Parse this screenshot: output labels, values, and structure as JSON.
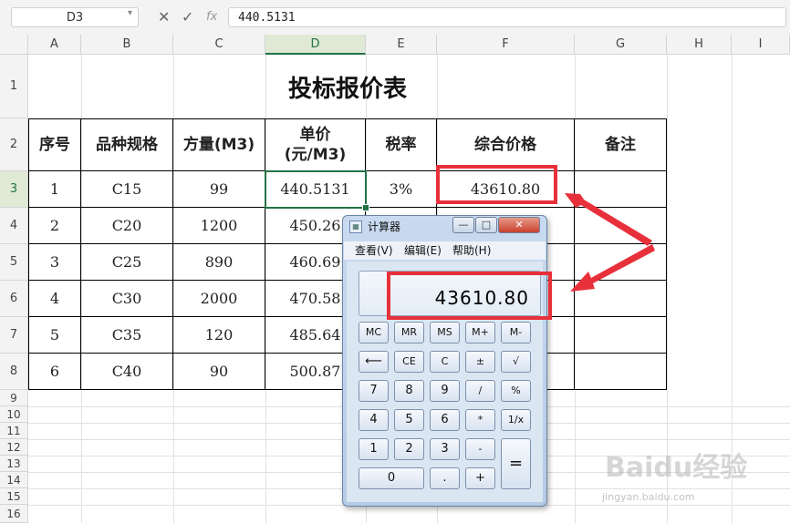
{
  "formula_bar": {
    "name_box": "D3",
    "cancel_icon": "✕",
    "confirm_icon": "✓",
    "fx_label": "fx",
    "formula": "440.5131"
  },
  "columns": [
    "A",
    "B",
    "C",
    "D",
    "E",
    "F",
    "G",
    "H",
    "I"
  ],
  "rows": [
    "1",
    "2",
    "3",
    "4",
    "5",
    "6",
    "7",
    "8",
    "9",
    "10",
    "11",
    "12",
    "13",
    "14",
    "15",
    "16"
  ],
  "sheet": {
    "title": "投标报价表",
    "headers": {
      "seq": "序号",
      "spec": "品种规格",
      "volume": "方量(M3)",
      "price_line1": "单价",
      "price_line2": "(元/M3)",
      "tax": "税率",
      "total": "综合价格",
      "note": "备注"
    },
    "data": [
      {
        "seq": "1",
        "spec": "C15",
        "volume": "99",
        "price": "440.5131",
        "tax": "3%",
        "total": "43610.80"
      },
      {
        "seq": "2",
        "spec": "C20",
        "volume": "1200",
        "price": "450.26",
        "tax": "",
        "total": ""
      },
      {
        "seq": "3",
        "spec": "C25",
        "volume": "890",
        "price": "460.69",
        "tax": "",
        "total": ""
      },
      {
        "seq": "4",
        "spec": "C30",
        "volume": "2000",
        "price": "470.58",
        "tax": "",
        "total": ""
      },
      {
        "seq": "5",
        "spec": "C35",
        "volume": "120",
        "price": "485.64",
        "tax": "",
        "total": ""
      },
      {
        "seq": "6",
        "spec": "C40",
        "volume": "90",
        "price": "500.87",
        "tax": "",
        "total": ""
      }
    ]
  },
  "calculator": {
    "title": "计算器",
    "window_buttons": {
      "minimize": "—",
      "maximize": "□",
      "close": "✕"
    },
    "menu": {
      "view": "查看(V)",
      "edit": "编辑(E)",
      "help": "帮助(H)"
    },
    "display": "43610.80",
    "keys": {
      "row1": [
        "MC",
        "MR",
        "MS",
        "M+",
        "M-"
      ],
      "row2": [
        "⟵",
        "CE",
        "C",
        "±",
        "√"
      ],
      "row3": [
        "7",
        "8",
        "9",
        "/",
        "%"
      ],
      "row4": [
        "4",
        "5",
        "6",
        "*",
        "1/x"
      ],
      "row5": [
        "1",
        "2",
        "3",
        "-"
      ],
      "row6": [
        "0",
        ".",
        "+"
      ],
      "equals": "="
    }
  },
  "watermark": {
    "brand": "Baidu经验",
    "url": "jingyan.baidu.com"
  },
  "colors": {
    "accent": "#217346",
    "highlight": "#e8303a"
  }
}
